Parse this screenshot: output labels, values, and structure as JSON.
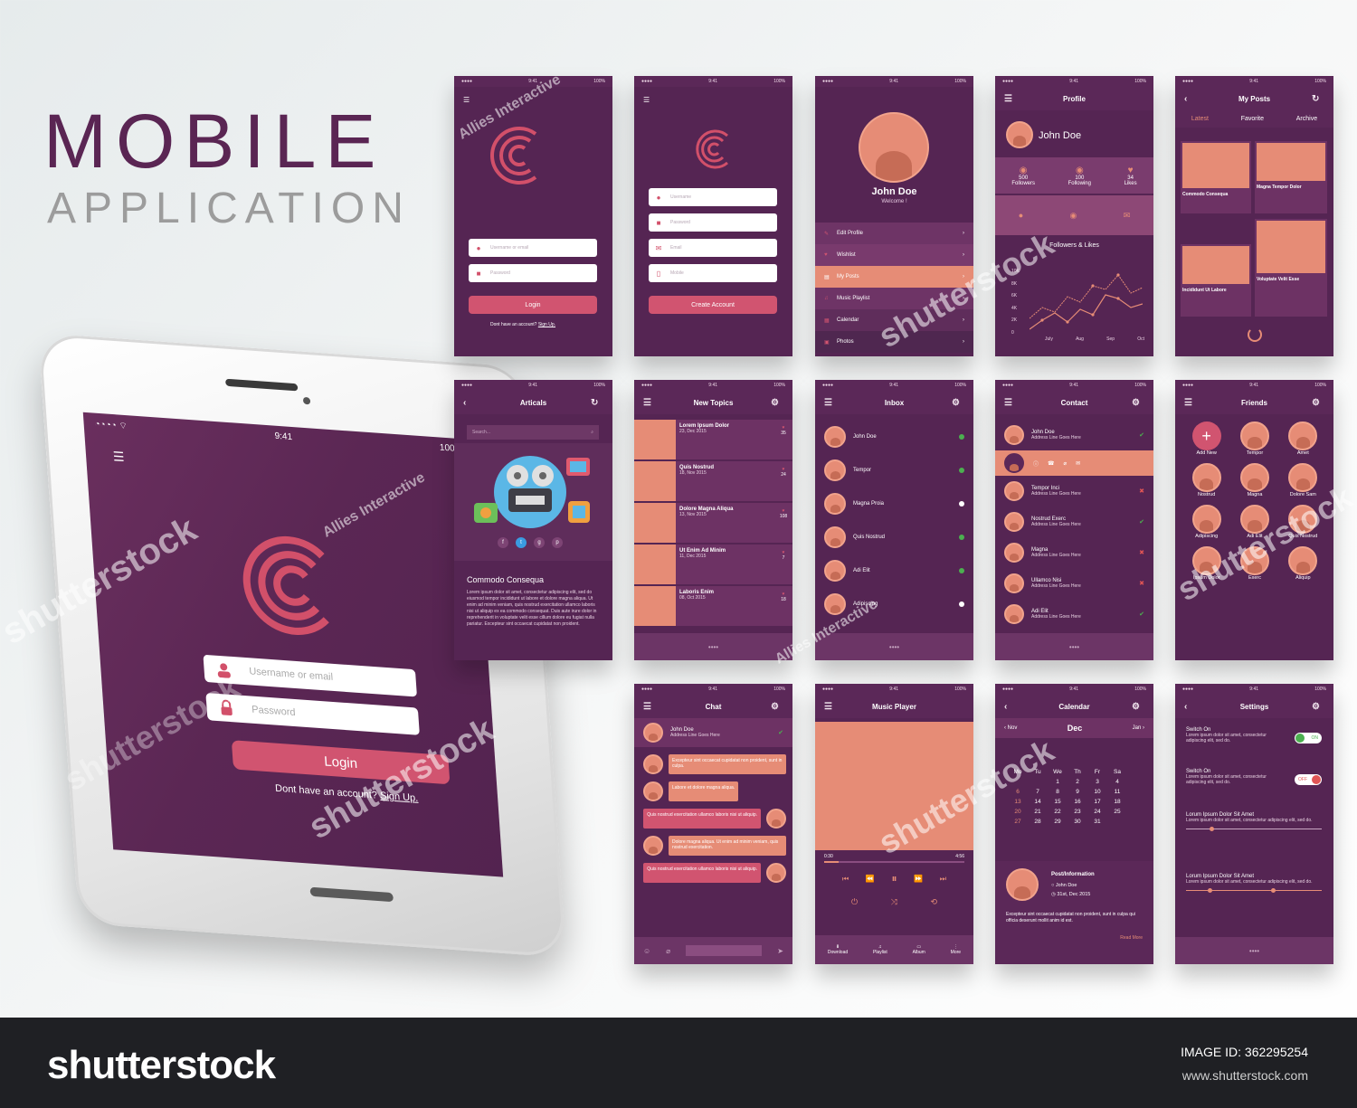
{
  "hero": {
    "title": "MOBILE",
    "subtitle": "APPLICATION"
  },
  "colors": {
    "primary": "#552553",
    "accent": "#d15470",
    "peach": "#e68c76",
    "online": "#4caf50",
    "offline": "#e05555"
  },
  "status": {
    "time": "9:41",
    "battery": "100%"
  },
  "phone": {
    "username_placeholder": "Username or email",
    "password_placeholder": "Password",
    "login": "Login",
    "signup_prefix": "Dont have an account?",
    "signup_link": "Sign Up."
  },
  "login_screen": {
    "username": "Username or email",
    "password": "Password",
    "login": "Login",
    "signup_prefix": "Dont have an account?",
    "signup_link": "Sign Up."
  },
  "register_screen": {
    "username": "Username",
    "password": "Password",
    "email": "Email",
    "mobile": "Mobile",
    "button": "Create Account"
  },
  "menu_screen": {
    "name": "John Doe",
    "welcome": "Welcome !",
    "items": [
      "Edit Profile",
      "Wishlist",
      "My Posts",
      "Music Playlist",
      "Calendar",
      "Photos"
    ]
  },
  "profile_screen": {
    "title": "Profile",
    "name": "John Doe",
    "stats": [
      {
        "value": "500",
        "label": "Followers"
      },
      {
        "value": "100",
        "label": "Following"
      },
      {
        "value": "34",
        "label": "Likes"
      }
    ],
    "section": "Followers & Likes",
    "yaxis": [
      "10K",
      "8K",
      "6K",
      "4K",
      "2K",
      "0"
    ],
    "xaxis": [
      "July",
      "Aug",
      "Sep",
      "Oct"
    ]
  },
  "posts_screen": {
    "title": "My Posts",
    "tabs": [
      "Latest",
      "Favorite",
      "Archive"
    ],
    "cards": [
      "Commodo Consequa",
      "Magna Tempor Dolor",
      "Incididunt Ut Labore",
      "Voluptate Velit Esse"
    ]
  },
  "articles_screen": {
    "title": "Articals",
    "search": "Search...",
    "heading": "Commodo Consequa",
    "body": "Lorem ipsum dolor sit amet, consectetur adipiscing elit, sed do eiusmod tempor incididunt ut labore et dolore magna aliqua. Ut enim ad minim veniam, quis nostrud exercitation ullamco laboris nisi ut aliquip ex ea commodo consequat. Duis aute irure dolor in reprehenderit in voluptate velit esse cillum dolore eu fugiat nulla pariatur. Excepteur sint occaecat cupidatat non proident."
  },
  "topics_screen": {
    "title": "New Topics",
    "items": [
      {
        "title": "Lorem Ipsum Dolor",
        "date": "23, Dec 2015",
        "count": "35"
      },
      {
        "title": "Quis Nostrud",
        "date": "18, Nov 2015",
        "count": "24"
      },
      {
        "title": "Dolore Magna Aliqua",
        "date": "13, Nov 2015",
        "count": "108"
      },
      {
        "title": "Ut Enim Ad Minim",
        "date": "11, Dec 2015",
        "count": "7"
      },
      {
        "title": "Laboris Enim",
        "date": "08, Oct 2015",
        "count": "18"
      }
    ]
  },
  "inbox_screen": {
    "title": "Inbox",
    "items": [
      "John Doe",
      "Tempor",
      "Magna Proia",
      "Quis Nostrud",
      "Adi Elit",
      "Adipiscing"
    ]
  },
  "contact_screen": {
    "title": "Contact",
    "items": [
      "John Doe",
      "Tempor Inci",
      "Nostrud Exerc",
      "Magna",
      "Ullamco Nisi",
      "Adi Elit"
    ],
    "sub": "Address Line Goes Here"
  },
  "friends_screen": {
    "title": "Friends",
    "items": [
      "Add New",
      "Tempor",
      "Amet",
      "Nostrud",
      "Magna",
      "Dolore Sam",
      "Adipiscing",
      "Adi Elit",
      "Quis Nostrud",
      "Ipsum Dolor",
      "Exerc",
      "Aliquip"
    ]
  },
  "chat_screen": {
    "title": "Chat",
    "contact": "John Doe",
    "sub": "Address Line Goes Here",
    "messages": [
      "Excepteur sint occaecat cupidatat non proident, sunt in culpa.",
      "Labore et dolore magna aliqua.",
      "Quis nostrud exercitation ullamco laboris nisi ut aliquip.",
      "Dolore magna aliqua. Ut enim ad minim veniam, quis nostrud exercitation.",
      "Quis nostrud exercitation ullamco laboris nisi ut aliquip."
    ]
  },
  "music_screen": {
    "title": "Music Player",
    "start": "0:30",
    "end": "4:56",
    "tabs": [
      "Download",
      "Playlist",
      "Album",
      "More"
    ]
  },
  "calendar_screen": {
    "title": "Calendar",
    "prev": "Nov",
    "month": "Dec",
    "next": "Jan",
    "days": [
      "Mo",
      "Tu",
      "We",
      "Th",
      "Fr",
      "Sa"
    ],
    "post_title": "Post/Information",
    "post_name": "John Doe",
    "post_date": "31st, Dec 2015",
    "body": "Excepteur sint occaecat cupidatat non proident, sunt in culpa qui officia deserunt mollit anim id est.",
    "more": "Read More"
  },
  "settings_screen": {
    "title": "Settings",
    "items": [
      {
        "title": "Switch On",
        "state": "ON"
      },
      {
        "title": "Switch On",
        "state": "OFF"
      },
      {
        "title": "Lorum Ipsum Dolor Sit Amet"
      },
      {
        "title": "Lorum Ipsum Dolor Sit Amet"
      }
    ],
    "desc": "Lorem ipsum dolor sit amet, consectetur adipiscing elit, sed do."
  },
  "watermarks": {
    "brand": "shutterstock",
    "agency": "Allies Interactive"
  },
  "footer": {
    "logo": "shutterstock",
    "image_id": "IMAGE ID: 362295254",
    "url": "www.shutterstock.com"
  }
}
